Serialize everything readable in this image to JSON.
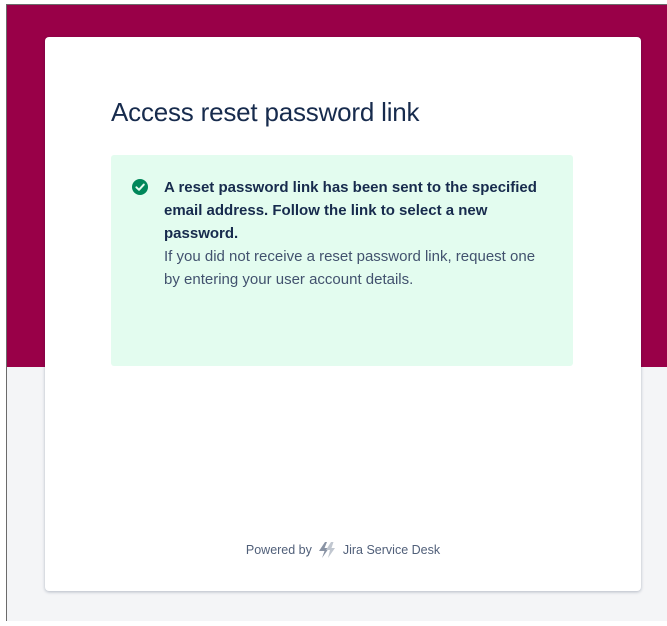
{
  "page": {
    "title": "Access reset password link"
  },
  "message": {
    "status": "success",
    "icon": "check-circle-icon",
    "heading": "A reset password link has been sent to the specified email address. Follow the link to select a new password.",
    "body": "If you did not receive a reset password link, request one by entering your user account details."
  },
  "footer": {
    "powered_by": "Powered by",
    "product": "Jira Service Desk",
    "product_icon": "jira-bolt-icon"
  },
  "colors": {
    "banner": "#990048",
    "success_bg": "#e3fcef",
    "success_icon": "#00875a",
    "title": "#172b4d",
    "text": "#42526e",
    "page_bg": "#f4f5f7"
  }
}
